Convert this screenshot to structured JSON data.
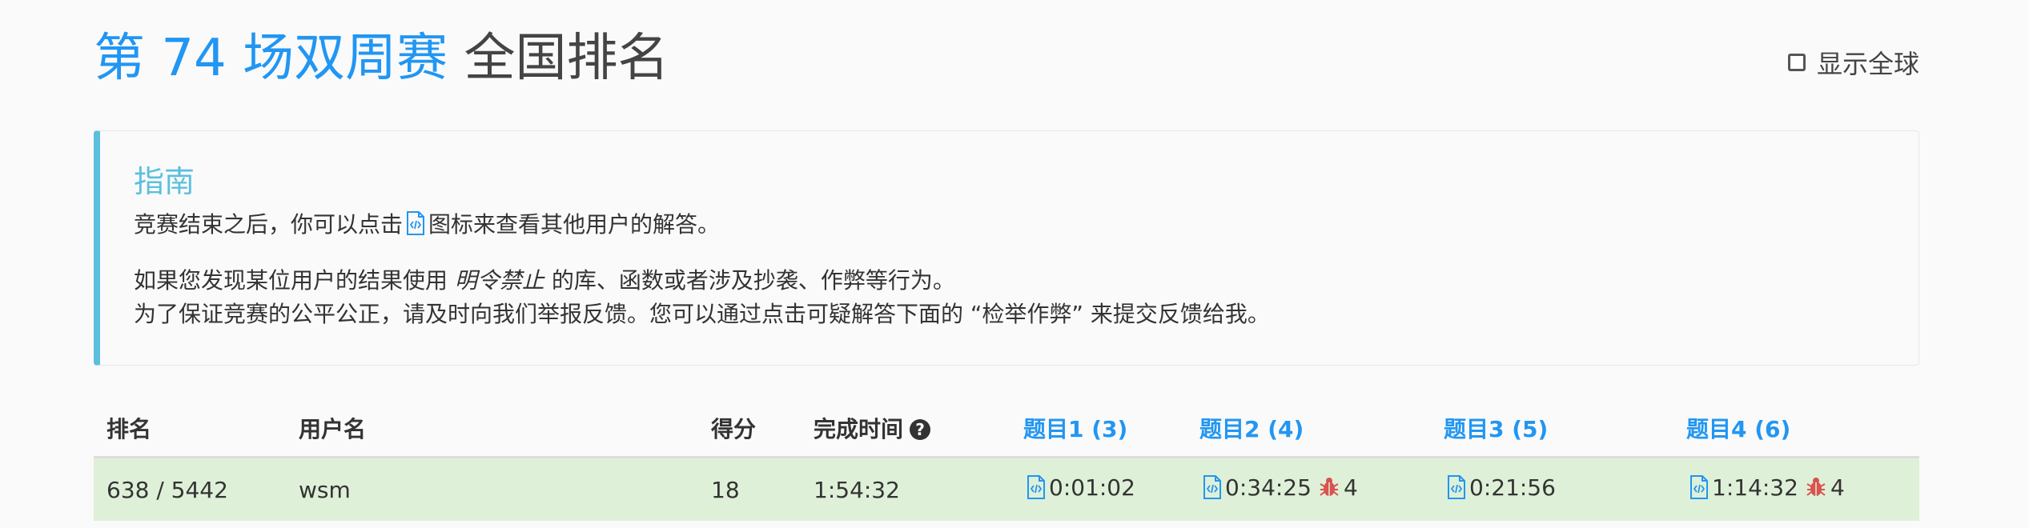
{
  "header": {
    "title_contest": "第 74 场双周赛",
    "title_rest": "全国排名",
    "show_global_label": "显示全球"
  },
  "guide": {
    "title": "指南",
    "line1_before": "竞赛结束之后，你可以点击",
    "line1_after": "图标来查看其他用户的解答。",
    "line2_before": "如果您发现某位用户的结果使用",
    "line2_em": "明令禁止",
    "line2_after": "的库、函数或者涉及抄袭、作弊等行为。",
    "line3": "为了保证竞赛的公平公正，请及时向我们举报反馈。您可以通过点击可疑解答下面的 “检举作弊” 来提交反馈给我。"
  },
  "table": {
    "headers": {
      "rank": "排名",
      "username": "用户名",
      "score": "得分",
      "finish_time": "完成时间",
      "q1": "题目1 (3)",
      "q2": "题目2 (4)",
      "q3": "题目3 (5)",
      "q4": "题目4 (6)"
    },
    "rows": [
      {
        "rank": "638 / 5442",
        "username": "wsm",
        "score": "18",
        "finish_time": "1:54:32",
        "q1_time": "0:01:02",
        "q2_time": "0:34:25",
        "q2_penalty": "4",
        "q3_time": "0:21:56",
        "q4_time": "1:14:32",
        "q4_penalty": "4"
      }
    ]
  },
  "colors": {
    "accent": "#2196f3",
    "guide_accent": "#5bc0de",
    "row_success": "#dff0d8",
    "bug": "#d9534f"
  },
  "icons": {
    "code": "code-file-icon",
    "help": "question-circle-icon",
    "bug": "bug-icon",
    "checkbox": "checkbox-icon"
  }
}
